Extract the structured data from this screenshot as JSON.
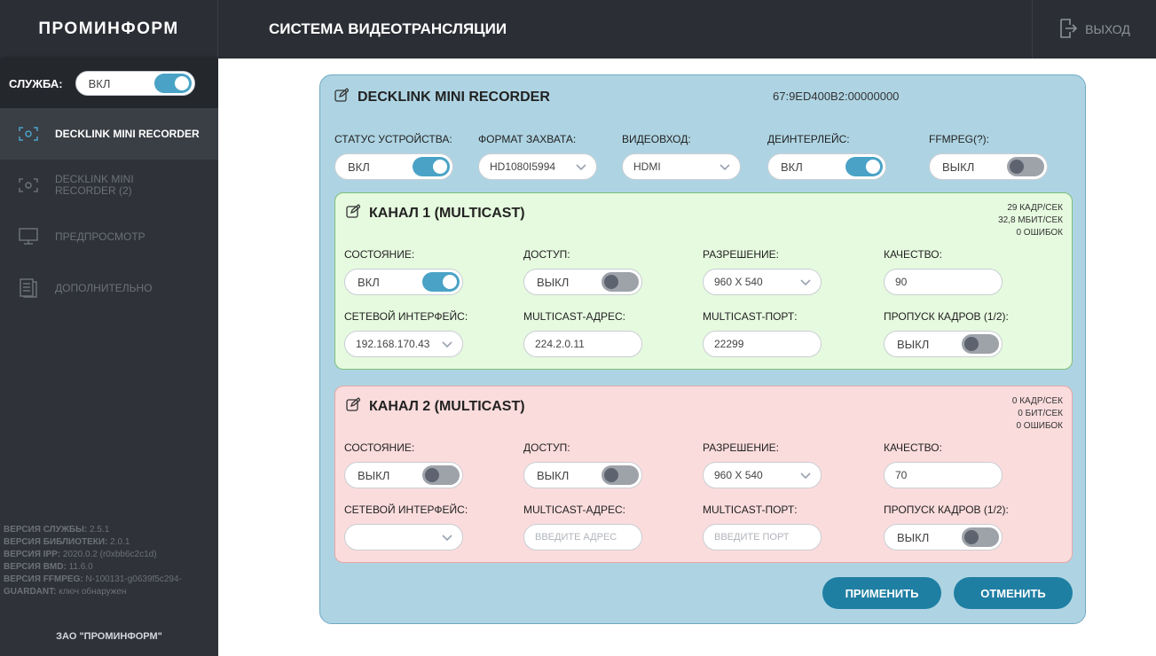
{
  "brand": "ПРОМИНФОРМ",
  "app_title": "СИСТЕМА ВИДЕОТРАНСЛЯЦИИ",
  "exit_label": "ВЫХОД",
  "service": {
    "label": "СЛУЖБА:",
    "state": "ВКЛ",
    "on": true
  },
  "nav": [
    {
      "label": "DECKLINK MINI RECORDER",
      "icon": "capture-icon",
      "active": true
    },
    {
      "label": "DECKLINK MINI RECORDER (2)",
      "icon": "capture-icon",
      "active": false
    },
    {
      "label": "ПРЕДПРОСМОТР",
      "icon": "monitor-icon",
      "active": false
    },
    {
      "label": "ДОПОЛНИТЕЛЬНО",
      "icon": "settings-doc-icon",
      "active": false
    }
  ],
  "versions": [
    {
      "key": "ВЕРСИЯ СЛУЖБЫ:",
      "value": "2.5.1"
    },
    {
      "key": "ВЕРСИЯ БИБЛИОТЕКИ:",
      "value": "2.0.1"
    },
    {
      "key": "ВЕРСИЯ IPP:",
      "value": "2020.0.2 (r0xbb6c2c1d)"
    },
    {
      "key": "ВЕРСИЯ BMD:",
      "value": "11.6.0"
    },
    {
      "key": "ВЕРСИЯ FFMPEG:",
      "value": "N-100131-g0639f5c294-"
    },
    {
      "key": "GUARDANT:",
      "value": "ключ обнаружен"
    }
  ],
  "company": "ЗАО \"ПРОМИНФОРМ\"",
  "device": {
    "title": "DECKLINK MINI RECORDER",
    "id": "67:9ED400B2:00000000",
    "status_label": "СТАТУС УСТРОЙСТВА:",
    "status_value": "ВКЛ",
    "format_label": "ФОРМАТ ЗАХВАТА:",
    "format_value": "HD1080I5994",
    "input_label": "ВИДЕОВХОД:",
    "input_value": "HDMI",
    "deint_label": "ДЕИНТЕРЛЕЙС:",
    "deint_value": "ВКЛ",
    "ffmpeg_label": "FFMPEG(?):",
    "ffmpeg_value": "ВЫКЛ"
  },
  "labels": {
    "state": "СОСТОЯНИЕ:",
    "access": "ДОСТУП:",
    "resolution": "РАЗРЕШЕНИЕ:",
    "quality": "КАЧЕСТВО:",
    "iface": "СЕТЕВОЙ ИНТЕРФЕЙС:",
    "mcast_addr": "MULTICAST-АДРЕС:",
    "mcast_port": "MULTICAST-ПОРТ:",
    "skip": "ПРОПУСК КАДРОВ (1/2):"
  },
  "channels": [
    {
      "title": "КАНАЛ 1 (MULTICAST)",
      "fps": "29 КАДР/СЕК",
      "bitrate": "32,8 МБИТ/СЕК",
      "errors": "0 ОШИБОК",
      "state": "ВКЛ",
      "access": "ВЫКЛ",
      "resolution": "960 X 540",
      "quality": "90",
      "iface": "192.168.170.43",
      "mcast_addr": "224.2.0.11",
      "mcast_port": "22299",
      "skip": "ВЫКЛ"
    },
    {
      "title": "КАНАЛ 2 (MULTICAST)",
      "fps": "0 КАДР/СЕК",
      "bitrate": "0 БИТ/СЕК",
      "errors": "0 ОШИБОК",
      "state": "ВЫКЛ",
      "access": "ВЫКЛ",
      "resolution": "960 X 540",
      "quality": "70",
      "iface": "",
      "mcast_addr_placeholder": "ВВЕДИТЕ АДРЕС",
      "mcast_port_placeholder": "ВВЕДИТЕ ПОРТ",
      "skip": "ВЫКЛ"
    }
  ],
  "buttons": {
    "apply": "ПРИМЕНИТЬ",
    "cancel": "ОТМЕНИТЬ"
  },
  "colors": {
    "accent": "#1f7fa3",
    "toggle_on": "#4aa3c6",
    "device_bg": "#aed4e3",
    "channel_ok": "#e6fadf",
    "channel_err": "#fbdcdc"
  }
}
